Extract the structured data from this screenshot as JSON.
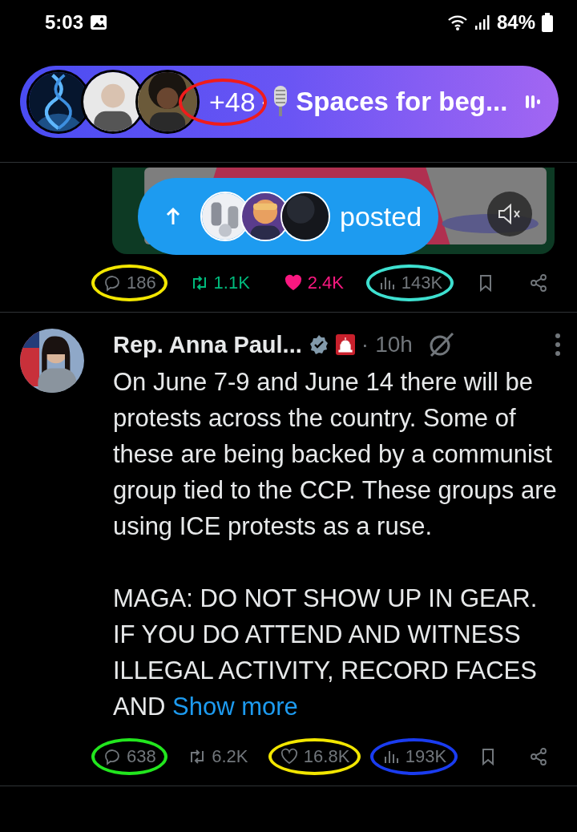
{
  "status_bar": {
    "time": "5:03",
    "battery": "84%"
  },
  "spaces": {
    "count": "+48",
    "separator": "·",
    "title": "Spaces for beg...",
    "color": "#f01c1c"
  },
  "posted_pill": {
    "label": "posted"
  },
  "posts": [
    {
      "stats": [
        {
          "kind": "reply",
          "count": "186",
          "active": false,
          "color": "#f2e600"
        },
        {
          "kind": "repost",
          "count": "1.1K",
          "active": true
        },
        {
          "kind": "like",
          "count": "2.4K",
          "active": true
        },
        {
          "kind": "views",
          "count": "143K",
          "active": false,
          "color": "#3ee0d0"
        },
        {
          "kind": "bookmark",
          "active": false
        },
        {
          "kind": "share",
          "active": false
        }
      ]
    },
    {
      "author": "Rep. Anna Paul...",
      "separator": "·",
      "time": "10h",
      "body": "On June 7-9 and June 14 there will be protests across the country. Some of these are being backed by a communist group tied to the CCP. These groups are using ICE protests as a ruse.\n\nMAGA: DO NOT SHOW UP IN GEAR. IF YOU DO ATTEND AND WITNESS ILLEGAL ACTIVITY, RECORD FACES AND ",
      "show_more": "Show more",
      "stats": [
        {
          "kind": "reply",
          "count": "638",
          "active": false,
          "color": "#22e61e"
        },
        {
          "kind": "repost",
          "count": "6.2K",
          "active": false
        },
        {
          "kind": "like",
          "count": "16.8K",
          "active": false,
          "color": "#f2e600"
        },
        {
          "kind": "views",
          "count": "193K",
          "active": false,
          "color": "#1a3cf0"
        },
        {
          "kind": "bookmark",
          "active": false
        },
        {
          "kind": "share",
          "active": false
        }
      ]
    }
  ]
}
